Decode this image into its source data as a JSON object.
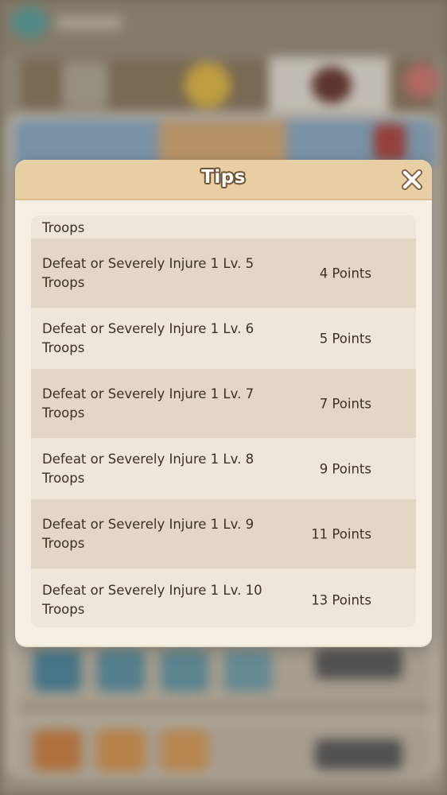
{
  "dialog": {
    "title": "Tips",
    "close_icon": "close-x-icon"
  },
  "rewards": [
    {
      "description": "Troops",
      "points": ""
    },
    {
      "description": "Defeat or Severely Injure 1 Lv. 5 Troops",
      "points": "4 Points"
    },
    {
      "description": "Defeat or Severely Injure 1 Lv. 6 Troops",
      "points": "5 Points"
    },
    {
      "description": "Defeat or Severely Injure 1 Lv. 7 Troops",
      "points": "7 Points"
    },
    {
      "description": "Defeat or Severely Injure 1 Lv. 8 Troops",
      "points": "9 Points"
    },
    {
      "description": "Defeat or Severely Injure 1 Lv. 9 Troops",
      "points": "11 Points"
    },
    {
      "description": "Defeat or Severely Injure 1 Lv. 10 Troops",
      "points": "13 Points"
    }
  ],
  "colors": {
    "header": "#e8cfa3",
    "dialog_bg": "#f6f0e4",
    "row_dark": "#e2d7c4",
    "row_light": "#eee6d9",
    "text": "#3b3026",
    "title_outline": "#6e5133"
  }
}
